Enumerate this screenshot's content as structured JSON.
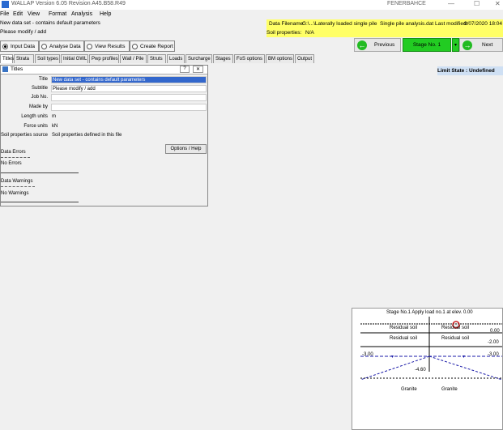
{
  "app": {
    "title": "WALLAP  Version 6.05  Revision A45.B58.R49",
    "host": "FENERBAHCE"
  },
  "window_controls": {
    "minimize": "—",
    "maximize": "☐",
    "close": "✕"
  },
  "menu": [
    "File",
    "Edit",
    "View",
    "Format",
    "Analysis",
    "Help"
  ],
  "info": {
    "line1": "New data set - contains default parameters",
    "line2": "Please modify / add",
    "data_filename_label": "Data Filename:",
    "data_filename": "G:\\...\\Laterally loaded single pile",
    "file_name": "Single pile analysis.dat",
    "last_modified_label": "Last modified:",
    "last_modified": "9/07/2020 18:04",
    "soil_label": "Soil properties:",
    "soil_value": "N/A"
  },
  "modes": [
    {
      "label": "Input Data",
      "on": true
    },
    {
      "label": "Analyse Data",
      "on": false
    },
    {
      "label": "View Results",
      "on": false
    },
    {
      "label": "Create Report",
      "on": false
    }
  ],
  "nav": {
    "previous": "Previous",
    "stage": "Stage No.  1",
    "next": "Next",
    "dropdown": "▾"
  },
  "tabs": [
    "Titles",
    "Strata",
    "Soil types",
    "Initial GWL",
    "Pwp profiles",
    "Wall / Pile",
    "Struts",
    "Loads",
    "Surcharge",
    "Stages",
    "FoS options",
    "BM options",
    "Output"
  ],
  "limit_state": "Limit State :    Undefined",
  "titles_window": {
    "header": "Titles",
    "help": "?",
    "close": "✕",
    "fields": [
      {
        "label": "Title",
        "value": "New data set - contains default parameters"
      },
      {
        "label": "Subtitle",
        "value": "Please modify / add"
      },
      {
        "label": "Job No.",
        "value": ""
      },
      {
        "label": "Made by",
        "value": ""
      },
      {
        "label": "Length units",
        "value": "m"
      },
      {
        "label": "Force units",
        "value": "kN"
      },
      {
        "label": "Soil properties source",
        "value": "Soil properties defined in this file"
      }
    ],
    "options_button": "Options / Help",
    "data_errors_label": "Data Errors",
    "data_errors_value": "No Errors",
    "data_warnings_label": "Data Warnings",
    "data_warnings_value": "No Warnings"
  },
  "stage_panel": {
    "title": "Stage No.1   Apply load no.1 at elev. 0.00",
    "rows": [
      {
        "left": "Residual soil",
        "right": "Residual soil",
        "elev": "0.00"
      },
      {
        "left": "Residual soil",
        "right": "Residual soil",
        "elev": "-2.00"
      }
    ],
    "elev_left": "-3.00",
    "elev_right": "-3.00",
    "pile_toe": "-4.60",
    "bottom_left": "Granite",
    "bottom_right": "Granite"
  },
  "colors": {
    "accent_green": "#22cc22",
    "info_yellow": "#ffff66",
    "selection_blue": "#3367cc"
  }
}
